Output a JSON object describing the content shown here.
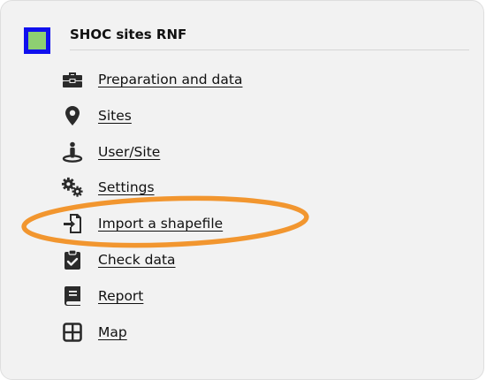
{
  "project": {
    "title": "SHOC sites RNF",
    "logo_colors": {
      "border": "#1010ee",
      "fill": "#8ecf72"
    }
  },
  "menu": {
    "items": [
      {
        "label": "Preparation and data",
        "icon": "toolbox-icon"
      },
      {
        "label": "Sites",
        "icon": "map-pin-icon"
      },
      {
        "label": "User/Site",
        "icon": "user-location-icon"
      },
      {
        "label": "Settings",
        "icon": "gears-icon"
      },
      {
        "label": "Import a shapefile",
        "icon": "file-import-icon"
      },
      {
        "label": "Check data",
        "icon": "clipboard-check-icon"
      },
      {
        "label": "Report",
        "icon": "book-icon"
      },
      {
        "label": "Map",
        "icon": "grid-icon"
      }
    ]
  },
  "annotation": {
    "highlighted_item": "Import a shapefile",
    "color": "#f2962f"
  }
}
